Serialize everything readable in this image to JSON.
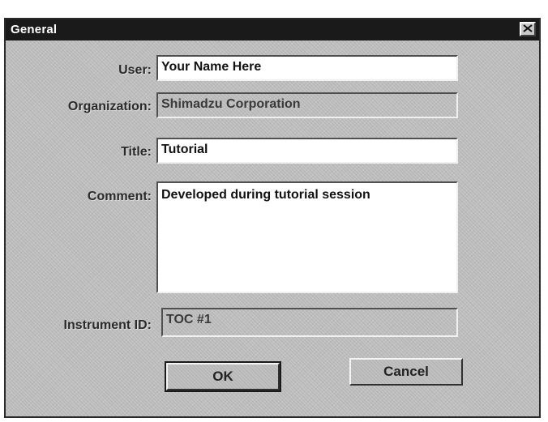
{
  "dialog": {
    "title": "General",
    "close_icon": "close-x-icon"
  },
  "fields": {
    "user": {
      "label": "User:",
      "value": "Your Name Here"
    },
    "organization": {
      "label": "Organization:",
      "value": "Shimadzu Corporation"
    },
    "title": {
      "label": "Title:",
      "value": "Tutorial"
    },
    "comment": {
      "label": "Comment:",
      "value": "Developed during tutorial session"
    },
    "instrument_id": {
      "label": "Instrument ID:",
      "value": "TOC #1"
    }
  },
  "buttons": {
    "ok_label": "OK",
    "cancel_label": "Cancel"
  },
  "colors": {
    "title_bar": "#1a1a1a",
    "dialog_face": "#c0c0c0",
    "input_bg": "#ffffff"
  }
}
